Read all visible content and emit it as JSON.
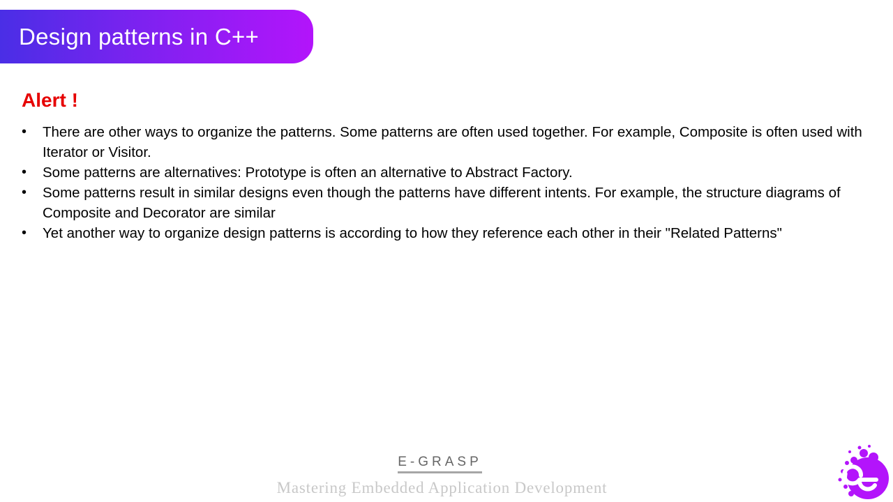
{
  "slide": {
    "title": "Design patterns in C++",
    "heading": "Alert !",
    "bullets": [
      "There are other ways to organize the patterns. Some patterns are often used together.  For example, Composite is often used with Iterator or Visitor.",
      "Some patterns are alternatives: Prototype is often an alternative to Abstract Factory.",
      "Some patterns result in similar designs even though the patterns have different intents. For example, the structure diagrams of Composite and Decorator are similar",
      "Yet another way to organize design patterns is according to how they reference each other in their \"Related Patterns\""
    ],
    "bullet_symbol": "•"
  },
  "footer": {
    "brand": "E-GRASP",
    "tagline": "Mastering Embedded Application Development"
  },
  "logo": {
    "icon": "e-grasp-logo-icon"
  },
  "colors": {
    "banner_start": "#4a2ee6",
    "banner_end": "#b314fb",
    "heading": "#e60000",
    "logo": "#b314fb"
  }
}
